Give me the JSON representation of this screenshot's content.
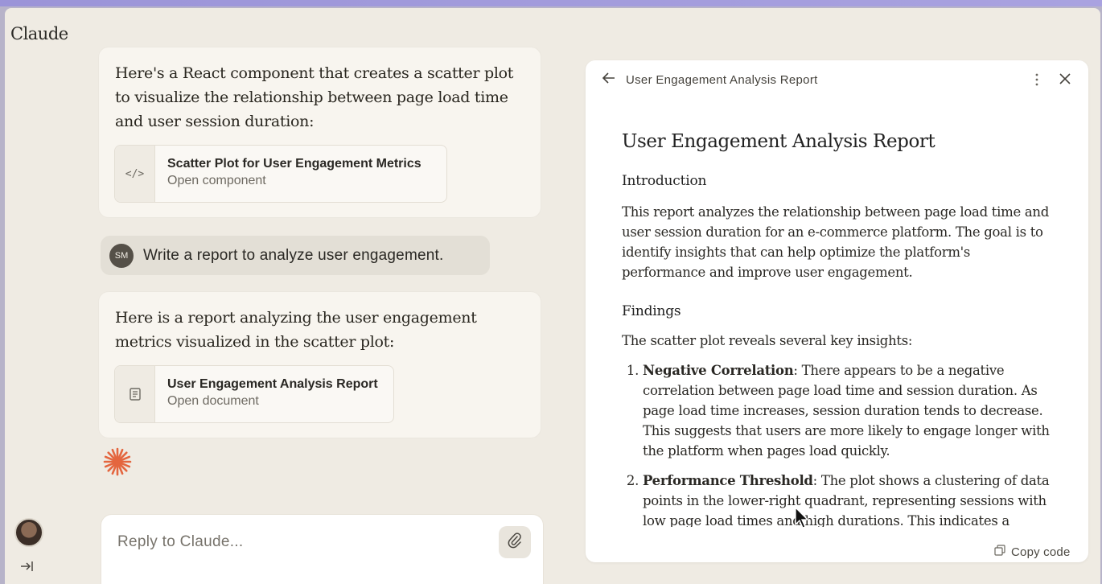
{
  "app": {
    "brand": "Claude"
  },
  "chat": {
    "assistant_msg_1": "Here's a React component that creates a scatter plot to visualize the relationship between page load time and user session duration:",
    "artifact_1": {
      "icon": "code-icon",
      "title": "Scatter Plot for User Engagement Metrics",
      "subtitle": "Open component"
    },
    "user_msg": {
      "initials": "SM",
      "text": "Write a report to analyze user engagement."
    },
    "assistant_msg_2": "Here is a report analyzing the user engagement metrics visualized in the scatter plot:",
    "artifact_2": {
      "icon": "document-icon",
      "title": "User Engagement Analysis Report",
      "subtitle": "Open document"
    },
    "composer": {
      "placeholder": "Reply to Claude..."
    },
    "accent_color": "#e4663f"
  },
  "panel": {
    "title": "User Engagement Analysis Report",
    "copy_label": "Copy code",
    "doc": {
      "heading": "User Engagement Analysis Report",
      "intro_heading": "Introduction",
      "intro_text": "This report analyzes the relationship between page load time and user session duration for an e-commerce platform. The goal is to identify insights that can help optimize the platform's performance and improve user engagement.",
      "findings_heading": "Findings",
      "findings_lead": "The scatter plot reveals several key insights:",
      "findings": [
        {
          "title": "Negative Correlation",
          "text": ": There appears to be a negative correlation between page load time and session duration. As page load time increases, session duration tends to decrease. This suggests that users are more likely to engage longer with the platform when pages load quickly."
        },
        {
          "title": "Performance Threshold",
          "text": ": The plot shows a clustering of data points in the lower-right quadrant, representing sessions with low page load times and high durations. This indicates a"
        }
      ]
    }
  }
}
